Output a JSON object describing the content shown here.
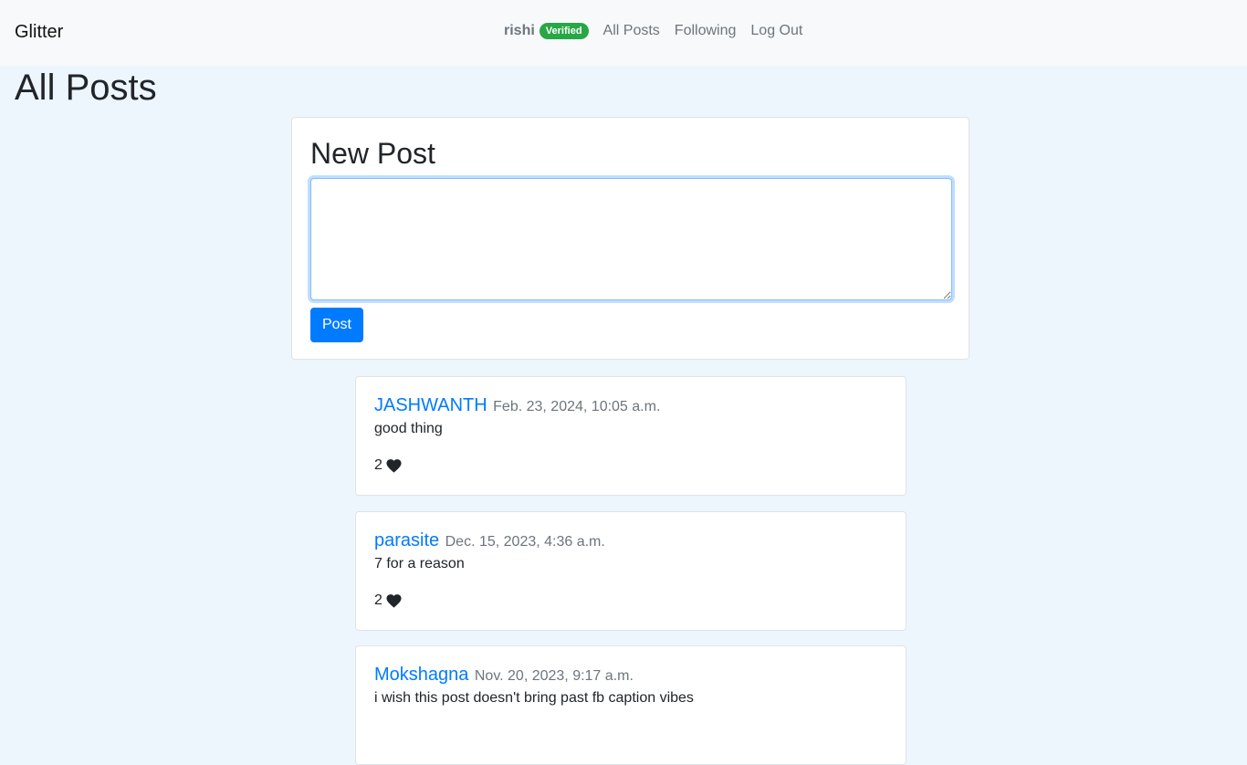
{
  "navbar": {
    "brand": "Glitter",
    "username": "rishi",
    "badge": "Verified",
    "links": [
      "All Posts",
      "Following",
      "Log Out"
    ]
  },
  "page": {
    "title": "All Posts"
  },
  "new_post": {
    "title": "New Post",
    "textarea_value": "",
    "button_label": "Post"
  },
  "posts": [
    {
      "author": "JASHWANTH",
      "date": "Feb. 23, 2024, 10:05 a.m.",
      "body": "good thing",
      "likes": "2"
    },
    {
      "author": "parasite",
      "date": "Dec. 15, 2023, 4:36 a.m.",
      "body": "7 for a reason",
      "likes": "2"
    },
    {
      "author": "Mokshagna",
      "date": "Nov. 20, 2023, 9:17 a.m.",
      "body": "i wish this post doesn't bring past fb caption vibes",
      "likes": ""
    }
  ],
  "colors": {
    "accent": "#007bff",
    "badge": "#28a745",
    "background": "#eef6fd"
  },
  "icons": {
    "like": "heart-icon"
  }
}
